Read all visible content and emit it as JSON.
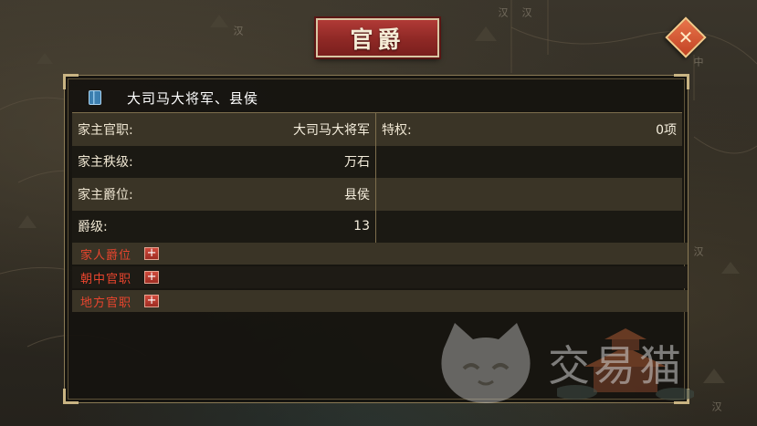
{
  "title": "官爵",
  "close_icon": "close-x-icon",
  "header": {
    "icon": "book-icon",
    "title": "大司马大将军、县侯"
  },
  "info": {
    "rows": [
      {
        "label": "家主官职:",
        "value": "大司马大将军"
      },
      {
        "label": "家主秩级:",
        "value": "万石"
      },
      {
        "label": "家主爵位:",
        "value": "县侯"
      },
      {
        "label": "爵级:",
        "value": "13"
      }
    ],
    "privilege": {
      "label": "特权:",
      "value": "0项"
    }
  },
  "sections": [
    {
      "label": "家人爵位",
      "button": "+"
    },
    {
      "label": "朝中官职",
      "button": "+"
    },
    {
      "label": "地方官职",
      "button": "+"
    }
  ],
  "map_labels": [
    "汉",
    "汉",
    "汉",
    "中",
    "汉",
    "汉"
  ],
  "watermark": "交易猫",
  "colors": {
    "plaque_red": "#9a2c28",
    "accent_gold": "#c9b483",
    "section_label_red": "#e8452e"
  }
}
